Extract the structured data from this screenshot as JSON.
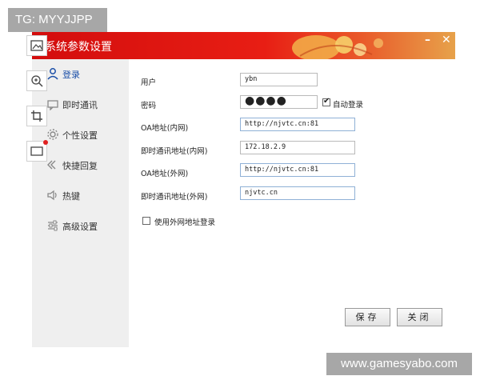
{
  "watermarks": {
    "top_left": "TG: MYYJJPP",
    "bottom_right": "www.gamesyabo.com"
  },
  "window": {
    "title": "系统参数设置",
    "minimize_label": "–",
    "close_label": "✕"
  },
  "sidebar": {
    "items": [
      {
        "label": "登录",
        "icon": "user-icon",
        "active": true
      },
      {
        "label": "即时通讯",
        "icon": "chat-icon",
        "active": false
      },
      {
        "label": "个性设置",
        "icon": "gear-icon",
        "active": false
      },
      {
        "label": "快捷回复",
        "icon": "reply-icon",
        "active": false
      },
      {
        "label": "热键",
        "icon": "speaker-icon",
        "active": false
      },
      {
        "label": "高级设置",
        "icon": "sliders-icon",
        "active": false
      }
    ]
  },
  "form": {
    "user_label": "用户",
    "user_value": "ybn",
    "password_label": "密码",
    "password_value": "●●●●",
    "auto_login_label": "自动登录",
    "auto_login_checked": true,
    "oa_internal_label": "OA地址(内网)",
    "oa_internal_value": "http://njvtc.cn:81",
    "im_internal_label": "即时通讯地址(内网)",
    "im_internal_value": "172.18.2.9",
    "oa_external_label": "OA地址(外网)",
    "oa_external_value": "http://njvtc.cn:81",
    "im_external_label": "即时通讯地址(外网)",
    "im_external_value": "njvtc.cn",
    "use_external_label": "使用外网地址登录",
    "use_external_checked": false
  },
  "buttons": {
    "save_label": "保存",
    "close_label": "关闭"
  },
  "colors": {
    "title_red": "#d30d0d",
    "active_blue": "#1b4fa8",
    "sidebar_bg": "#efefef"
  }
}
